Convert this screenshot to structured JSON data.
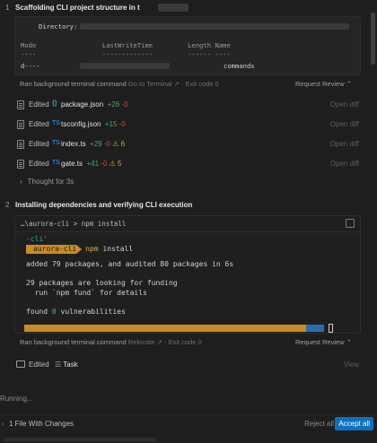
{
  "steps": [
    {
      "number": "1",
      "title": "Scaffolding CLI project structure in t"
    },
    {
      "number": "2",
      "title": "Installing dependencies and verifying CLI execution"
    }
  ],
  "listing": {
    "directory_label": "Directory:",
    "headers": "Mode                 LastWriteTime         Length Name",
    "dashes": "----                 -------------         ------ ----",
    "row_mode": "d----",
    "row_name": "commands"
  },
  "command_footer_1": {
    "label": "Ran background terminal command",
    "link": "Go to Terminal",
    "exit": "· Exit code 0",
    "review": "Request Review"
  },
  "edits": [
    {
      "verb": "Edited",
      "icon": "{}",
      "icon_color": "#3ca3c2",
      "file": "package.json",
      "plus": "+26",
      "minus": "-0",
      "warnings": "",
      "action": "Open diff"
    },
    {
      "verb": "Edited",
      "icon": "TS",
      "icon_color": "#3178c6",
      "file": "tsconfig.json",
      "plus": "+15",
      "minus": "-0",
      "warnings": "",
      "action": "Open diff"
    },
    {
      "verb": "Edited",
      "icon": "TS",
      "icon_color": "#3178c6",
      "file": "index.ts",
      "plus": "+29",
      "minus": "-0",
      "warnings": "6",
      "action": "Open diff"
    },
    {
      "verb": "Edited",
      "icon": "TS",
      "icon_color": "#3178c6",
      "file": "gate.ts",
      "plus": "+41",
      "minus": "-0",
      "warnings": "5",
      "action": "Open diff"
    }
  ],
  "thought": "Thought for 3s",
  "run": {
    "cmdline": "…\\aurora-cli > npm install",
    "tag": "-cli'",
    "prompt_dir": "aurora-cli",
    "prompt_cmd": "npm",
    "prompt_arg": "install",
    "line1": "added 79 packages, and audited 80 packages in 6s",
    "line2": "29 packages are looking for funding",
    "line3": "  run `npm fund` for details",
    "line4_pre": "found ",
    "line4_zero": "0",
    "line4_post": " vulnerabilities"
  },
  "command_footer_2": {
    "label": "Ran background terminal command",
    "link": "Relocate",
    "exit": "· Exit code 0",
    "review": "Request Review"
  },
  "task": {
    "verb": "Edited",
    "name": "Task",
    "action": "View"
  },
  "running": "Running...",
  "bottom": {
    "changes": "1 File With Changes",
    "reject": "Reject all",
    "accept": "Accept all"
  },
  "colors": {
    "accent": "#0e70c0",
    "prompt": "#c98c20",
    "added": "#4fa35c",
    "removed": "#c74e4e",
    "warning": "#d9a23a"
  }
}
